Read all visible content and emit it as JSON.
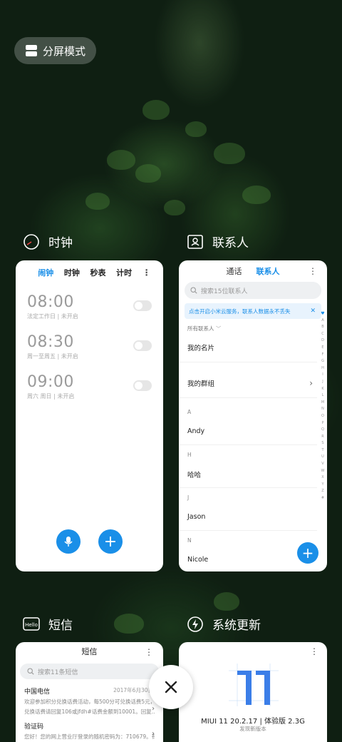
{
  "split_mode": {
    "label": "分屏模式"
  },
  "apps": {
    "clock": {
      "name": "时钟",
      "tabs": [
        "闹钟",
        "时钟",
        "秒表",
        "计时"
      ],
      "alarms": [
        {
          "time": "08:00",
          "desc": "法定工作日 | 未开启"
        },
        {
          "time": "08:30",
          "desc": "周一至周五 | 未开启"
        },
        {
          "time": "09:00",
          "desc": "周六 周日 | 未开启"
        }
      ]
    },
    "contacts": {
      "name": "联系人",
      "tabs": [
        "通话",
        "联系人"
      ],
      "search_placeholder": "搜索15位联系人",
      "notice": "点击开启小米云服务，联系人数据永不丢失",
      "all_contacts": "所有联系人",
      "my_card": "我的名片",
      "my_groups": "我的群组",
      "sections": [
        {
          "letter": "A",
          "name": "Andy"
        },
        {
          "letter": "H",
          "name": "哈哈"
        },
        {
          "letter": "J",
          "name": "Jason"
        },
        {
          "letter": "N",
          "name": "Nicole"
        }
      ],
      "index_letters": [
        "A",
        "B",
        "C",
        "D",
        "E",
        "F",
        "G",
        "H",
        "I",
        "J",
        "K",
        "L",
        "M",
        "N",
        "O",
        "P",
        "Q",
        "R",
        "S",
        "T",
        "U",
        "V",
        "W",
        "X",
        "Y",
        "Z",
        "#"
      ]
    },
    "messages": {
      "name": "短信",
      "title": "短信",
      "search_placeholder": "搜索11条短信",
      "items": [
        {
          "from": "中国电信",
          "date": "2017年6月30日",
          "body1": "欢迎参加积分兑换话费活动，每500分可兑换话费5元，",
          "body2": "兑换话费请回复106或jfdh#话费金额到10001。回复..."
        },
        {
          "from": "验证码",
          "date": "",
          "body1": "您好！您的网上营业厅登录的随机密码为：710679。有",
          "body2": ""
        }
      ]
    },
    "updater": {
      "name": "系统更新",
      "version": "MIUI 11 20.2.17 | 体验版 2.3G",
      "subtitle": "发现新版本"
    }
  },
  "colors": {
    "accent": "#1a8fe8"
  }
}
